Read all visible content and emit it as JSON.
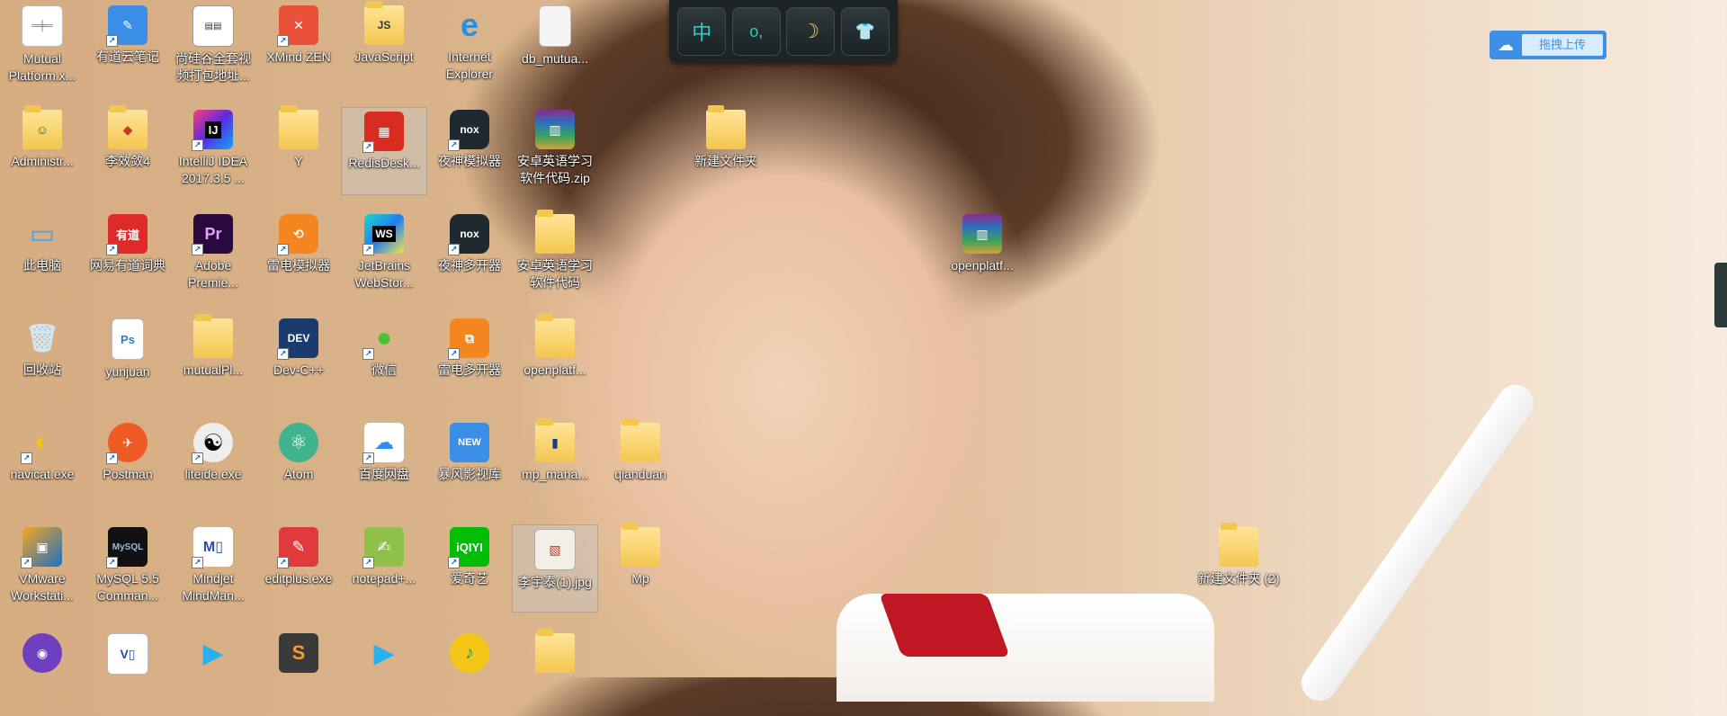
{
  "toolbar": {
    "buttons": [
      {
        "name": "chinese-input-mode",
        "glyph": "中"
      },
      {
        "name": "punctuation-mode",
        "glyph": "o,"
      },
      {
        "name": "night-mode",
        "glyph": "☽"
      },
      {
        "name": "skin",
        "glyph": "👕"
      }
    ]
  },
  "upload": {
    "label": "拖拽上传",
    "icon": "☁"
  },
  "icons": {
    "c0r0": "Mutual Platform.x...",
    "c1r0": "有道云笔记",
    "c2r0": "尚硅谷全套视频打包地址...",
    "c3r0": "XMind ZEN",
    "c4r0": "JavaScript",
    "c5r0": "Internet Explorer",
    "c6r0": "db_mutua...",
    "c0r1": "Administr...",
    "c1r1": "李效敛4",
    "c2r1": "IntelliJ IDEA 2017.3.5 ...",
    "c3r1": "Y",
    "c4r1": "RedisDesk...",
    "c5r1": "夜神模拟器",
    "c6r1": "安卓英语学习软件代码.zip",
    "c8r1": "新建文件夹",
    "c0r2": "此电脑",
    "c1r2": "网易有道词典",
    "c2r2": "Adobe Premie...",
    "c3r2": "雷电模拟器",
    "c4r2": "JetBrains WebStor...",
    "c5r2": "夜神多开器",
    "c6r2": "安卓英语学习软件代码",
    "c11r2": "openplatf...",
    "c0r3": "回收站",
    "c1r3": "yunjuan",
    "c2r3": "mutualPl...",
    "c3r3": "Dev-C++",
    "c4r3": "微信",
    "c5r3": "雷电多开器",
    "c6r3": "openplatf...",
    "c0r4": "navicat.exe",
    "c1r4": "Postman",
    "c2r4": "liteide.exe",
    "c3r4": "Atom",
    "c4r4": "百度网盘",
    "c5r4": "暴风影视库",
    "c6r4": "mp_mana...",
    "c7r4": "qianduan",
    "c0r5": "VMware Workstati...",
    "c1r5": "MySQL 5.5 Comman...",
    "c2r5": "Mindjet MindMan...",
    "c3r5": "editplus.exe",
    "c4r5": "notepad+...",
    "c5r5": "爱奇艺",
    "c6r5": "李宇泰(1).jpg",
    "c7r5": "Mp",
    "c14r5": "新建文件夹 (2)"
  }
}
